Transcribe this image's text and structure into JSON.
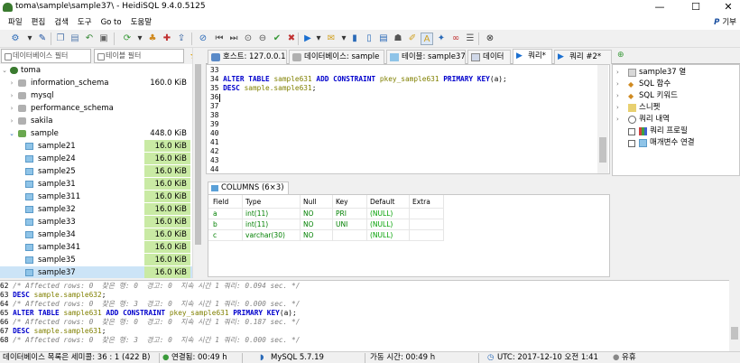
{
  "window": {
    "title": "toma\\sample\\sample37\\ - HeidiSQL 9.4.0.5125",
    "controls": {
      "minimize": "—",
      "maximize": "☐",
      "close": "✕"
    }
  },
  "menu": {
    "items": [
      "파일",
      "편집",
      "검색",
      "도구",
      "Go to",
      "도움말"
    ],
    "donate": "기부"
  },
  "filters": {
    "db_filter_placeholder": "데이터베이스 필터",
    "table_filter_placeholder": "테이블 필터"
  },
  "tree": {
    "root": "toma",
    "databases": [
      {
        "name": "information_schema",
        "size": "160.0 KiB"
      },
      {
        "name": "mysql",
        "size": ""
      },
      {
        "name": "performance_schema",
        "size": ""
      },
      {
        "name": "sakila",
        "size": ""
      },
      {
        "name": "sample",
        "size": "448.0 KiB"
      }
    ],
    "tables": [
      {
        "name": "sample21",
        "size": "16.0 KiB"
      },
      {
        "name": "sample24",
        "size": "16.0 KiB"
      },
      {
        "name": "sample25",
        "size": "16.0 KiB"
      },
      {
        "name": "sample31",
        "size": "16.0 KiB"
      },
      {
        "name": "sample311",
        "size": "16.0 KiB"
      },
      {
        "name": "sample32",
        "size": "16.0 KiB"
      },
      {
        "name": "sample33",
        "size": "16.0 KiB"
      },
      {
        "name": "sample34",
        "size": "16.0 KiB"
      },
      {
        "name": "sample341",
        "size": "16.0 KiB"
      },
      {
        "name": "sample35",
        "size": "16.0 KiB"
      },
      {
        "name": "sample37",
        "size": "16.0 KiB"
      }
    ]
  },
  "tabs": [
    {
      "label": "호스트: 127.0.0.1"
    },
    {
      "label": "데이터베이스: sample"
    },
    {
      "label": "테이블: sample37"
    },
    {
      "label": "데이터"
    },
    {
      "label": "쿼리*"
    },
    {
      "label": "쿼리 #2*"
    }
  ],
  "editor": {
    "lines": [
      {
        "n": "33",
        "code": ""
      },
      {
        "n": "34",
        "code": "ALTER TABLE sample631 ADD CONSTRAINT pkey_sample631 PRIMARY KEY(a);"
      },
      {
        "n": "35",
        "code": "DESC sample.sample631;"
      },
      {
        "n": "36",
        "code": ""
      },
      {
        "n": "37",
        "code": ""
      },
      {
        "n": "38",
        "code": ""
      },
      {
        "n": "39",
        "code": ""
      },
      {
        "n": "40",
        "code": ""
      },
      {
        "n": "41",
        "code": ""
      },
      {
        "n": "42",
        "code": ""
      },
      {
        "n": "43",
        "code": ""
      },
      {
        "n": "44",
        "code": ""
      }
    ]
  },
  "helpers": [
    {
      "label": "sample37 열",
      "type": "arrow"
    },
    {
      "label": "SQL 함수",
      "type": "arrow"
    },
    {
      "label": "SQL 키워드",
      "type": "arrow"
    },
    {
      "label": "스니펫",
      "type": "arrow"
    },
    {
      "label": "쿼리 내역",
      "type": "arrow"
    },
    {
      "label": "쿼리 프로필",
      "type": "check"
    },
    {
      "label": "매개변수 연결",
      "type": "check"
    }
  ],
  "result": {
    "tab_label": "COLUMNS (6×3)",
    "headers": [
      "Field",
      "Type",
      "Null",
      "Key",
      "Default",
      "Extra"
    ],
    "rows": [
      [
        "a",
        "int(11)",
        "NO",
        "PRI",
        "(NULL)",
        ""
      ],
      [
        "b",
        "int(11)",
        "NO",
        "UNI",
        "(NULL)",
        ""
      ],
      [
        "c",
        "varchar(30)",
        "NO",
        "",
        "(NULL)",
        ""
      ]
    ]
  },
  "log": [
    {
      "n": "62",
      "text": "/* Affected rows: 0  찾은 행: 0  경고: 0  지속 시간 1 쿼리: 0.094 sec. */",
      "kind": "comment"
    },
    {
      "n": "63",
      "text": "DESC sample.sample632;",
      "kind": "sql"
    },
    {
      "n": "64",
      "text": "/* Affected rows: 0  찾은 행: 3  경고: 0  지속 시간 1 쿼리: 0.000 sec. */",
      "kind": "comment"
    },
    {
      "n": "65",
      "text": "ALTER TABLE sample631 ADD CONSTRAINT pkey_sample631 PRIMARY KEY(a);",
      "kind": "sql"
    },
    {
      "n": "66",
      "text": "/* Affected rows: 0  찾은 행: 0  경고: 0  지속 시간 1 쿼리: 0.187 sec. */",
      "kind": "comment"
    },
    {
      "n": "67",
      "text": "DESC sample.sample631;",
      "kind": "sql"
    },
    {
      "n": "68",
      "text": "/* Affected rows: 0  찾은 행: 3  경고: 0  지속 시간 1 쿼리: 0.000 sec. */",
      "kind": "comment"
    }
  ],
  "status": {
    "db_info": "데이터베이스 목록은 세미콜: 36 : 1 (422 B)",
    "connected": "연결됨: 00:49 h",
    "server": "MySQL 5.7.19",
    "uptime": "가동 시간: 00:49 h",
    "utc": "UTC: 2017-12-10 오전 1:41",
    "idle": "유휴"
  },
  "colors": {
    "size_bar": "#c9eaa4",
    "keyword": "#0000cc",
    "identifier": "#808000",
    "comment": "#808080",
    "null_value": "#00a000",
    "key_value": "#008000"
  }
}
